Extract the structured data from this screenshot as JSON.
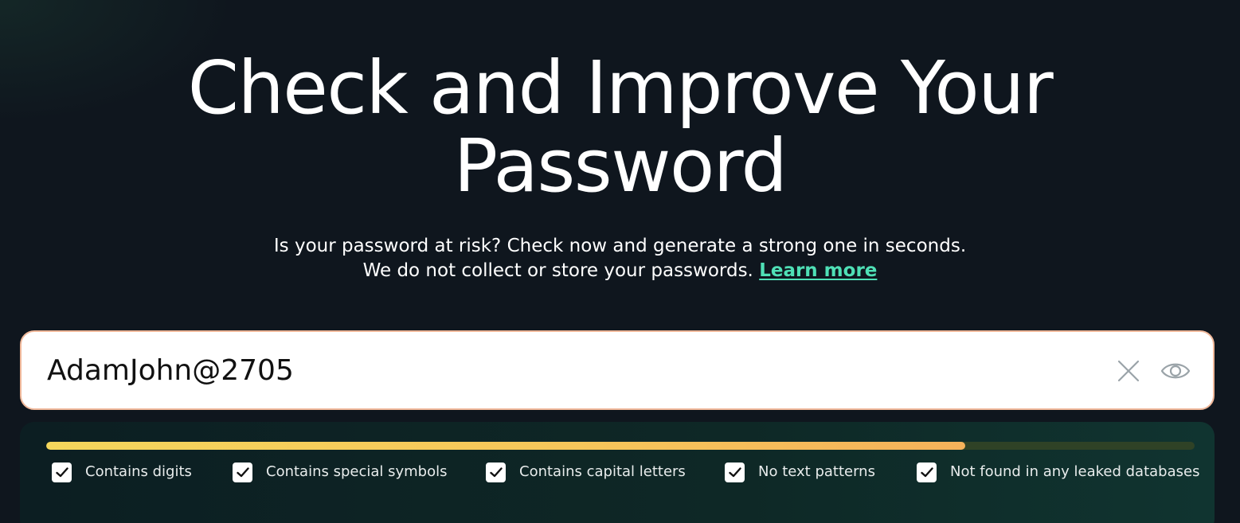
{
  "hero": {
    "title_line1": "Check and Improve Your",
    "title_line2": "Password"
  },
  "subtitle": {
    "line1": "Is your password at risk? Check now and generate a strong one in seconds.",
    "line2": "We do not collect or store your passwords.",
    "learn_more": "Learn more"
  },
  "password_field": {
    "value": "AdamJohn@2705",
    "clear_icon": "close-icon",
    "visibility_icon": "eye-icon"
  },
  "strength": {
    "fraction": 0.8,
    "colors": {
      "fill_start": "#f5d65c",
      "fill_end": "#f5b25a",
      "track": "#2f4226"
    }
  },
  "checks": [
    {
      "label": "Contains digits",
      "checked": true
    },
    {
      "label": "Contains special symbols",
      "checked": true
    },
    {
      "label": "Contains capital letters",
      "checked": true
    },
    {
      "label": "No text patterns",
      "checked": true
    },
    {
      "label": "Not found in any leaked databases",
      "checked": true
    }
  ],
  "colors": {
    "background": "#0f161e",
    "accent_link": "#4fe0b6",
    "input_border": "#f0b89a"
  }
}
